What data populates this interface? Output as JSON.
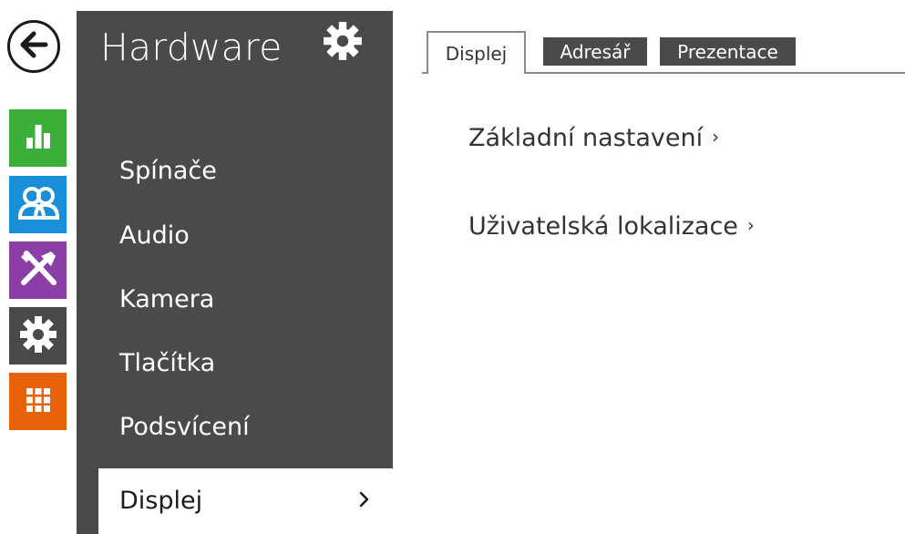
{
  "colors": {
    "sidebar_bg": "#4a4a4a",
    "status_green": "#3cae3a",
    "users_blue": "#1a8fd9",
    "services_purple": "#8b3fa6",
    "hardware_dark": "#4a4a4a",
    "system_orange": "#e8620a"
  },
  "left_bar": {
    "back_icon": "back-arrow-icon",
    "categories": [
      {
        "name": "status",
        "icon": "bar-chart-icon"
      },
      {
        "name": "users",
        "icon": "users-icon"
      },
      {
        "name": "services",
        "icon": "tools-icon"
      },
      {
        "name": "hardware",
        "icon": "gear-icon"
      },
      {
        "name": "system",
        "icon": "grid-icon"
      }
    ]
  },
  "sidebar": {
    "title": "Hardware",
    "title_icon": "gear-icon",
    "items": [
      {
        "label": "Spínače"
      },
      {
        "label": "Audio"
      },
      {
        "label": "Kamera"
      },
      {
        "label": "Tlačítka"
      },
      {
        "label": "Podsvícení"
      },
      {
        "label": "Displej",
        "active": true
      }
    ]
  },
  "tabs": [
    {
      "label": "Displej",
      "active": true
    },
    {
      "label": "Adresář"
    },
    {
      "label": "Prezentace"
    }
  ],
  "main": {
    "links": [
      {
        "label": "Základní nastavení",
        "arrow": "›"
      },
      {
        "label": "Uživatelská lokalizace",
        "arrow": "›"
      }
    ]
  }
}
